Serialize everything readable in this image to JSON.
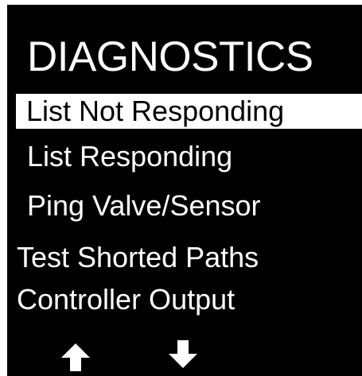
{
  "screen": {
    "title": "DIAGNOSTICS",
    "menu": [
      {
        "label": "List Not Responding",
        "selected": true
      },
      {
        "label": "List Responding",
        "selected": false
      },
      {
        "label": "Ping Valve/Sensor",
        "selected": false
      },
      {
        "label": "Test Shorted Paths",
        "selected": false
      },
      {
        "label": "Controller Output",
        "selected": false
      }
    ],
    "nav": {
      "up_icon": "arrow-up-icon",
      "down_icon": "arrow-down-icon"
    }
  },
  "colors": {
    "background": "#000000",
    "text": "#ffffff",
    "highlight_bg": "#ffffff",
    "highlight_text": "#000000"
  }
}
